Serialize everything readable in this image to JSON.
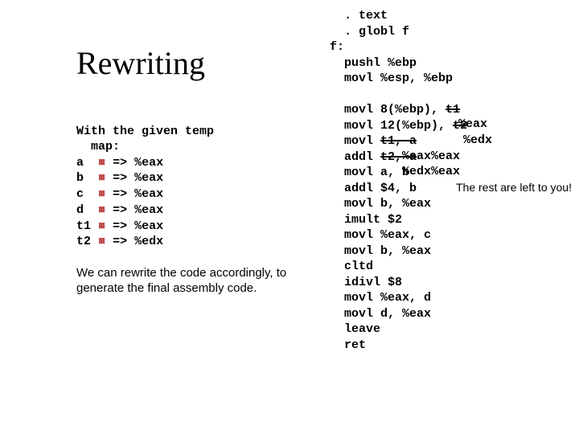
{
  "title": "Rewriting",
  "temp_intro": "With the given temp\n  map:",
  "mappings": [
    {
      "sym": "a",
      "reg": "%eax"
    },
    {
      "sym": "b",
      "reg": "%eax"
    },
    {
      "sym": "c",
      "reg": "%eax"
    },
    {
      "sym": "d",
      "reg": "%eax"
    },
    {
      "sym": "t1",
      "reg": "%eax"
    },
    {
      "sym": "t2",
      "reg": "%edx"
    }
  ],
  "arrow": "=>",
  "rewrite_text": "We can rewrite the code accordingly, to generate the final assembly code.",
  "code_pre": [
    "  . text",
    "  . globl f",
    "f:",
    "  pushl %ebp",
    "  movl %esp, %ebp"
  ],
  "code_main": [
    {
      "text": "  movl 8(%ebp), ",
      "strike": "t1",
      "after": ""
    },
    {
      "text": "  movl 12(%ebp), ",
      "strike": "t2",
      "after": ""
    },
    {
      "text": "  movl ",
      "strike": "t1, a",
      "after": ""
    },
    {
      "text": "  addl ",
      "strike": "t2, a",
      "after": ""
    },
    {
      "text": "  movl a, b",
      "strike": "",
      "after": ""
    },
    {
      "text": "  addl $4, b",
      "strike": "",
      "after": ""
    },
    {
      "text": "  movl b, %eax",
      "strike": "",
      "after": ""
    },
    {
      "text": "  imult $2",
      "strike": "",
      "after": ""
    },
    {
      "text": "  movl %eax, c",
      "strike": "",
      "after": ""
    },
    {
      "text": "  movl b, %eax",
      "strike": "",
      "after": ""
    },
    {
      "text": "  cltd",
      "strike": "",
      "after": ""
    },
    {
      "text": "  idivl $8",
      "strike": "",
      "after": ""
    },
    {
      "text": "  movl %eax, d",
      "strike": "",
      "after": ""
    },
    {
      "text": "  movl d, %eax",
      "strike": "",
      "after": ""
    },
    {
      "text": "  leave",
      "strike": "",
      "after": ""
    },
    {
      "text": "  ret",
      "strike": "",
      "after": ""
    }
  ],
  "anno": {
    "eax": "%eax",
    "edx": "%edx",
    "eaxeax": "%eax%eax",
    "edxeax": "%edx%eax",
    "rest": "The rest are\nleft to you!"
  }
}
